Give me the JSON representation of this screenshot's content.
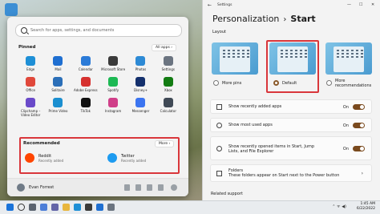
{
  "start_menu": {
    "search_placeholder": "Search for apps, settings, and documents",
    "pinned_title": "Pinned",
    "all_apps_label": "All apps  ›",
    "pinned_apps": [
      {
        "label": "Edge",
        "color": "#1e8fd6"
      },
      {
        "label": "Mail",
        "color": "#1f6fd1"
      },
      {
        "label": "Calendar",
        "color": "#2b7bd8"
      },
      {
        "label": "Microsoft Store",
        "color": "#3a3a3a"
      },
      {
        "label": "Photos",
        "color": "#2d8ad5"
      },
      {
        "label": "Settings",
        "color": "#6b7480"
      },
      {
        "label": "Office",
        "color": "#e0483b"
      },
      {
        "label": "Solitaire",
        "color": "#2b6fb8"
      },
      {
        "label": "Adobe Express",
        "color": "#d6312f"
      },
      {
        "label": "Spotify",
        "color": "#1db954"
      },
      {
        "label": "Disney+",
        "color": "#14306d"
      },
      {
        "label": "Xbox",
        "color": "#137c13"
      },
      {
        "label": "Clipchamp –\nVideo Editor",
        "color": "#6a4ac9"
      },
      {
        "label": "Prime Video",
        "color": "#1b8fd0"
      },
      {
        "label": "TikTok",
        "color": "#111111"
      },
      {
        "label": "Instagram",
        "color": "#d03f89"
      },
      {
        "label": "Messenger",
        "color": "#3b74f0"
      },
      {
        "label": "Calculator",
        "color": "#404a56"
      }
    ],
    "recommended_title": "Recommended",
    "more_label": "More  ›",
    "recommended": [
      {
        "name": "Reddit",
        "sub": "Recently added",
        "color": "#ff4500"
      },
      {
        "name": "Twitter",
        "sub": "Recently added",
        "color": "#1d9bf0"
      }
    ],
    "user_name": "Evan Forrest"
  },
  "settings": {
    "window_title": "Settings",
    "breadcrumb_parent": "Personalization",
    "breadcrumb_sep": "›",
    "breadcrumb_current": "Start",
    "layout_label": "Layout",
    "layout_options": [
      {
        "label": "More pins",
        "selected": false
      },
      {
        "label": "Default",
        "selected": true
      },
      {
        "label": "More\nrecommendations",
        "selected": false
      }
    ],
    "rows": [
      {
        "label": "Show recently added apps",
        "state": "On"
      },
      {
        "label": "Show most used apps",
        "state": "On"
      },
      {
        "label": "Show recently opened items in Start, Jump\nLists, and File Explorer",
        "state": "On"
      },
      {
        "label": "Folders\nThese folders appear on Start next to the Power button",
        "state": ""
      }
    ],
    "related_label": "Related support"
  },
  "taskbar": {
    "time": "1:45 AM",
    "date": "6/22/2022",
    "tray": "⌃  ᯤ ◀)"
  },
  "colors": {
    "accent": "#7a4a1e",
    "highlight_box": "#d9363b"
  }
}
